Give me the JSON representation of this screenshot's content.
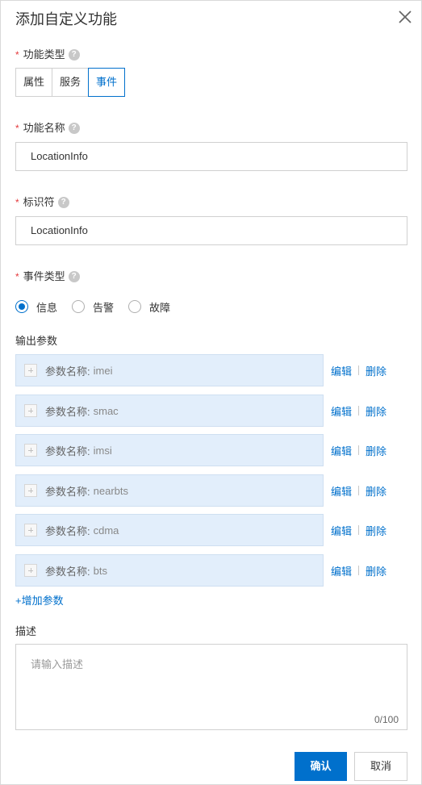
{
  "dialog": {
    "title": "添加自定义功能",
    "close_icon": "close-icon"
  },
  "function_type": {
    "required_mark": "*",
    "label": "功能类型",
    "help_glyph": "?",
    "options": [
      "属性",
      "服务",
      "事件"
    ],
    "selected": "事件"
  },
  "function_name": {
    "required_mark": "*",
    "label": "功能名称",
    "help_glyph": "?",
    "value": "LocationInfo"
  },
  "identifier": {
    "required_mark": "*",
    "label": "标识符",
    "help_glyph": "?",
    "value": "LocationInfo"
  },
  "event_type": {
    "required_mark": "*",
    "label": "事件类型",
    "help_glyph": "?",
    "options": [
      "信息",
      "告警",
      "故障"
    ],
    "selected": "信息"
  },
  "output_params": {
    "label": "输出参数",
    "prefix": "参数名称:",
    "edit_label": "编辑",
    "delete_label": "删除",
    "items": [
      {
        "name": "imei"
      },
      {
        "name": "smac"
      },
      {
        "name": "imsi"
      },
      {
        "name": "nearbts"
      },
      {
        "name": "cdma"
      },
      {
        "name": "bts"
      }
    ],
    "add_label": "+增加参数"
  },
  "description": {
    "label": "描述",
    "placeholder": "请输入描述",
    "counter": "0/100"
  },
  "footer": {
    "confirm_label": "确认",
    "cancel_label": "取消"
  },
  "colors": {
    "accent": "#0070cc",
    "required": "#e4393c",
    "param_bg": "#e2eefb"
  }
}
